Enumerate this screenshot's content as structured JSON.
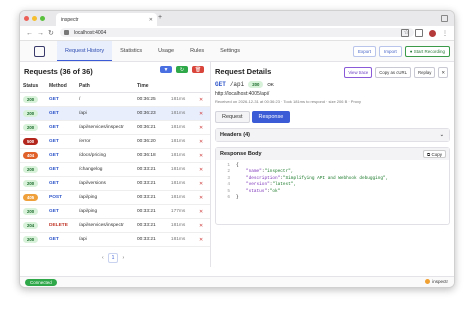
{
  "browser": {
    "tab_title": "inspectr",
    "url": "localhost:4004"
  },
  "nav": {
    "tabs": [
      "Request History",
      "Statistics",
      "Usage",
      "Rules",
      "Settings"
    ],
    "export": "Export",
    "import": "Import",
    "start_recording": "Start Recording"
  },
  "list": {
    "title": "Requests (36 of 36)",
    "columns": [
      "Status",
      "Method",
      "Path",
      "Time"
    ],
    "rows": [
      {
        "status": "200",
        "method": "GET",
        "path": "/",
        "time": "00:36:25",
        "dur": "181ms",
        "cls": "b200"
      },
      {
        "status": "200",
        "method": "GET",
        "path": "/api",
        "time": "00:36:23",
        "dur": "181ms",
        "cls": "b200"
      },
      {
        "status": "200",
        "method": "GET",
        "path": "/api/services/inspectr",
        "time": "00:36:21",
        "dur": "181ms",
        "cls": "b200"
      },
      {
        "status": "500",
        "method": "GET",
        "path": "/error",
        "time": "00:36:20",
        "dur": "181ms",
        "cls": "b500"
      },
      {
        "status": "404",
        "method": "GET",
        "path": "/docs/pricing",
        "time": "00:36:18",
        "dur": "181ms",
        "cls": "b404"
      },
      {
        "status": "200",
        "method": "GET",
        "path": "/changelog",
        "time": "00:33:21",
        "dur": "181ms",
        "cls": "b200"
      },
      {
        "status": "200",
        "method": "GET",
        "path": "/api/versions",
        "time": "00:33:21",
        "dur": "181ms",
        "cls": "b200"
      },
      {
        "status": "405",
        "method": "POST",
        "path": "/api/ping",
        "time": "00:33:21",
        "dur": "181ms",
        "cls": "b405"
      },
      {
        "status": "200",
        "method": "GET",
        "path": "/api/ping",
        "time": "00:33:21",
        "dur": "177ms",
        "cls": "b200"
      },
      {
        "status": "204",
        "method": "DELETE",
        "path": "/api/services/inspectr",
        "time": "00:33:21",
        "dur": "181ms",
        "cls": "b204"
      },
      {
        "status": "200",
        "method": "GET",
        "path": "/api",
        "time": "00:33:21",
        "dur": "181ms",
        "cls": "b200"
      }
    ],
    "page": "1"
  },
  "detail": {
    "title": "Request Details",
    "view_trace": "View trace",
    "copy_curl": "Copy as cURL",
    "replay": "Replay",
    "method": "GET",
    "path": "/api",
    "status": "200",
    "status_text": "OK",
    "url": "http://localhost:4005/api/",
    "meta": "Received on 2026-12-31 at 00:36:23 · Took 181ms to respond · size 206 B · Proxy",
    "tabs": [
      "Request",
      "Response"
    ],
    "headers_label": "Headers (4)",
    "body_label": "Response Body",
    "copy": "Copy",
    "code": [
      {
        "n": "1",
        "t": "{"
      },
      {
        "n": "2",
        "k": "\"name\"",
        "v": "\"inspectr\","
      },
      {
        "n": "3",
        "k": "\"description\"",
        "v": "\"Simplifying API and Webhook debugging\","
      },
      {
        "n": "4",
        "k": "\"version\"",
        "v": "\"latest\","
      },
      {
        "n": "5",
        "k": "\"status\"",
        "v": "\"ok\""
      },
      {
        "n": "6",
        "t": "}"
      }
    ]
  },
  "statusbar": {
    "connected": "Connected",
    "brand": "inspectr"
  }
}
